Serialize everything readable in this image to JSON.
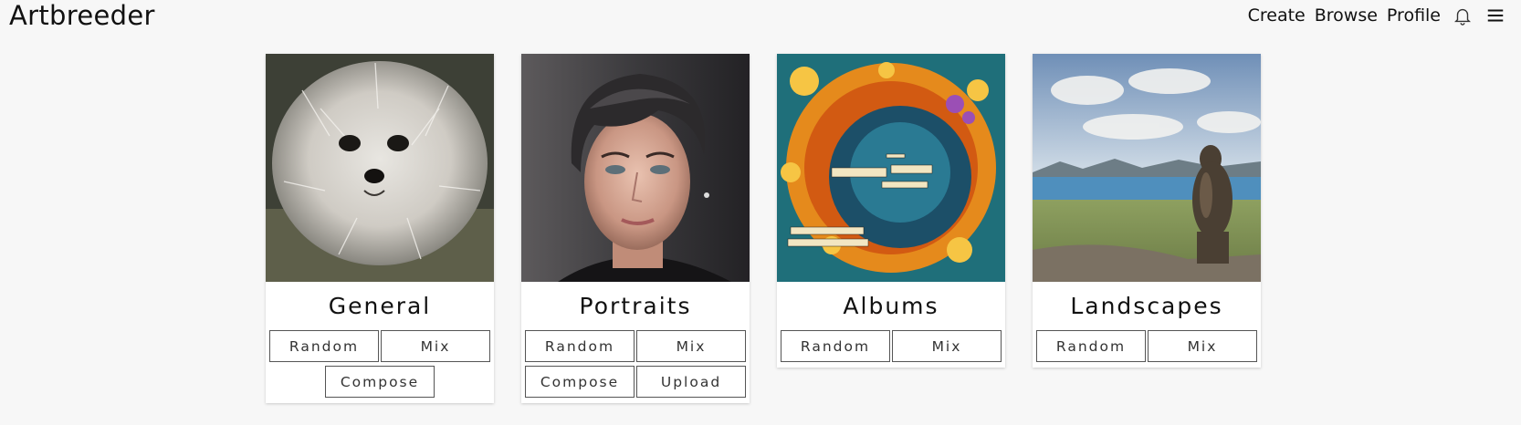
{
  "header": {
    "logo": "Artbreeder",
    "nav": {
      "create": "Create",
      "browse": "Browse",
      "profile": "Profile",
      "notifications_icon": "bell-icon",
      "menu_icon": "hamburger-menu-icon"
    }
  },
  "cards": [
    {
      "title": "General",
      "image": "fluffy white dog",
      "buttons": [
        "Random",
        "Mix",
        "Compose"
      ]
    },
    {
      "title": "Portraits",
      "image": "painted portrait of a short-haired woman",
      "buttons": [
        "Random",
        "Mix",
        "Compose",
        "Upload"
      ]
    },
    {
      "title": "Albums",
      "image": "colorful abstract album cover",
      "buttons": [
        "Random",
        "Mix"
      ]
    },
    {
      "title": "Landscapes",
      "image": "lake landscape with rock figure",
      "buttons": [
        "Random",
        "Mix"
      ]
    }
  ]
}
